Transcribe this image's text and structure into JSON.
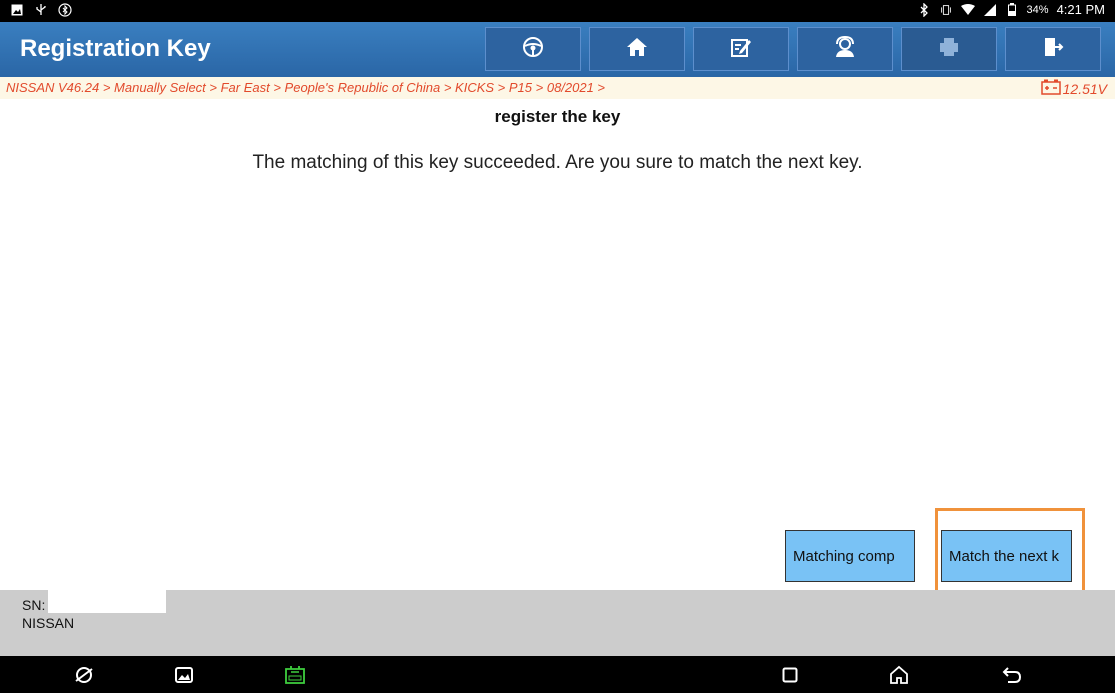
{
  "status_bar": {
    "battery_percent": "34%",
    "time": "4:21 PM"
  },
  "header": {
    "title": "Registration Key"
  },
  "toolbar": {
    "buttons": [
      {
        "name": "steering-wheel-icon"
      },
      {
        "name": "home-icon"
      },
      {
        "name": "edit-icon"
      },
      {
        "name": "support-icon"
      },
      {
        "name": "print-icon"
      },
      {
        "name": "exit-icon"
      }
    ]
  },
  "breadcrumb": {
    "path": "NISSAN V46.24 > Manually Select > Far East > People's Republic of China > KICKS > P15 > 08/2021 >",
    "voltage": "12.51V"
  },
  "content": {
    "heading": "register the key",
    "message": "The matching of this key succeeded. Are you sure to match the next key."
  },
  "actions": {
    "matching_complete_label": "Matching comp",
    "match_next_label": "Match the next k"
  },
  "info": {
    "sn_label": "SN:",
    "make": "NISSAN"
  },
  "colors": {
    "header": "#2a66a6",
    "breadcrumb_text": "#e24a2c",
    "button": "#79c2f5",
    "highlight": "#f0923b",
    "vci": "#3fcf3f"
  }
}
